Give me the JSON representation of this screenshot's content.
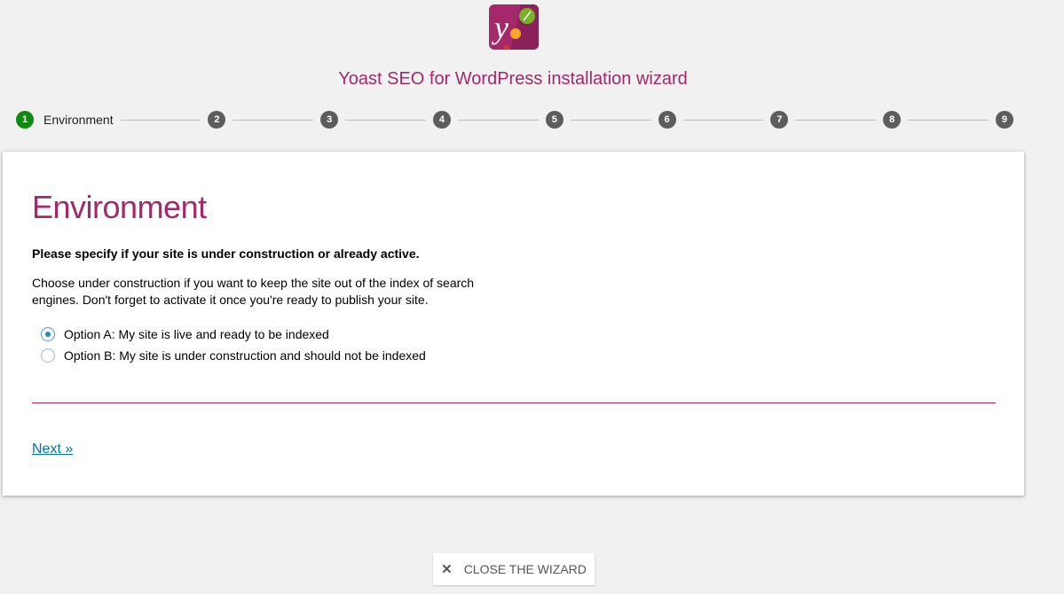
{
  "header": {
    "title": "Yoast SEO for WordPress installation wizard",
    "logo_icon": "yoast-logo-icon"
  },
  "stepper": {
    "steps": [
      {
        "number": "1",
        "label": "Environment",
        "active": true
      },
      {
        "number": "2"
      },
      {
        "number": "3"
      },
      {
        "number": "4"
      },
      {
        "number": "5"
      },
      {
        "number": "6"
      },
      {
        "number": "7"
      },
      {
        "number": "8"
      },
      {
        "number": "9"
      }
    ]
  },
  "content": {
    "title": "Environment",
    "question": "Please specify if your site is under construction or already active.",
    "description": "Choose under construction if you want to keep the site out of the index of search engines. Don't forget to activate it once you're ready to publish your site.",
    "options": [
      {
        "label": "Option A: My site is live and ready to be indexed",
        "checked": true
      },
      {
        "label": "Option B: My site is under construction and should not be indexed",
        "checked": false
      }
    ],
    "next_label": "Next »"
  },
  "footer": {
    "close_label": "CLOSE THE WIZARD",
    "close_icon": "close-icon"
  },
  "colors": {
    "brand": "#a4286a",
    "active_step": "#0f8a0f",
    "inactive_step": "#5d5d5d",
    "link": "#0073aa"
  }
}
